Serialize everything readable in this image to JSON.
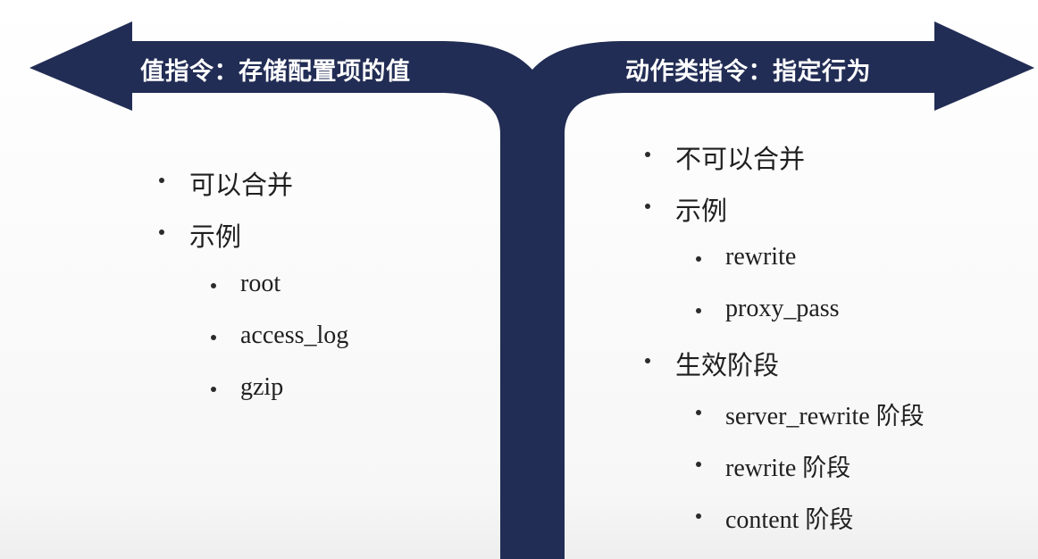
{
  "colors": {
    "arrow": "#222d55",
    "text": "#1f1f1f",
    "title_text": "#ffffff"
  },
  "left": {
    "title": "值指令：存储配置项的值",
    "items": {
      "mergeable": "可以合并",
      "example": "示例",
      "examples": [
        "root",
        "access_log",
        "gzip"
      ]
    }
  },
  "right": {
    "title": "动作类指令：指定行为",
    "items": {
      "not_mergeable": "不可以合并",
      "example": "示例",
      "examples": [
        "rewrite",
        "proxy_pass"
      ],
      "phase_heading": "生效阶段",
      "phases": [
        {
          "name": "server_rewrite",
          "suffix": "阶段"
        },
        {
          "name": "rewrite",
          "suffix": "阶段"
        },
        {
          "name": "content",
          "suffix": "阶段"
        }
      ]
    }
  }
}
